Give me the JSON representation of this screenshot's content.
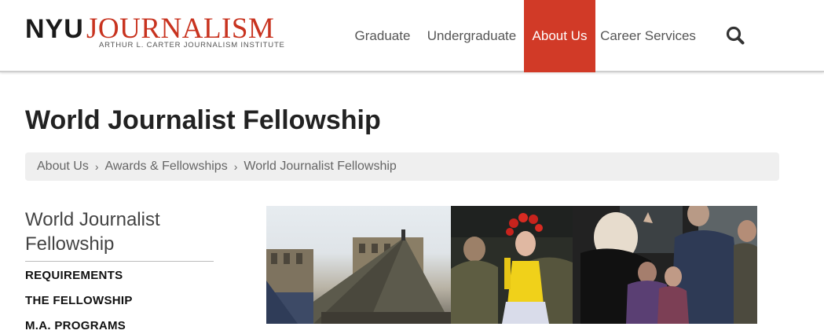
{
  "header": {
    "logo": {
      "nyu": "NYU",
      "journalism": "JOURNALISM",
      "subtitle": "ARTHUR L. CARTER JOURNALISM INSTITUTE"
    },
    "nav": [
      {
        "label": "Graduate",
        "active": false
      },
      {
        "label": "Undergraduate",
        "active": false
      },
      {
        "label": "About Us",
        "active": true
      },
      {
        "label": "Career Services",
        "active": false
      }
    ],
    "search_icon": "search-icon"
  },
  "page": {
    "title": "World Journalist Fellowship"
  },
  "breadcrumb": {
    "items": [
      "About Us",
      "Awards & Fellowships",
      "World Journalist Fellowship"
    ],
    "separator": "›"
  },
  "sidebar": {
    "title": "World Journalist Fellowship",
    "links": [
      "REQUIREMENTS",
      "THE FELLOWSHIP",
      "M.A. PROGRAMS"
    ]
  },
  "colors": {
    "brand_red": "#d13a27",
    "logo_red": "#c8331f",
    "breadcrumb_bg": "#efefef"
  }
}
